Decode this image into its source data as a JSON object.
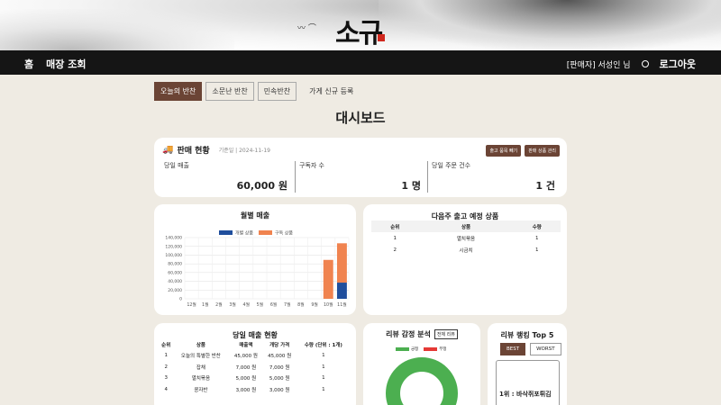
{
  "header": {
    "logo_text": "소규",
    "nav_left": [
      "홈",
      "매장 조회"
    ],
    "seller": "[판매자] 서성인 님",
    "logout": "로그아웃"
  },
  "store_tabs": [
    {
      "label": "오늘의 반찬",
      "active": true
    },
    {
      "label": "소문난 반찬",
      "active": false
    },
    {
      "label": "민속반찬",
      "active": false
    }
  ],
  "register_label": "가게 신규 등록",
  "page_title": "대시보드",
  "sales": {
    "title": "판매 현황",
    "date": "기준일 | 2024-11-19",
    "btn_bulk": "출고 품목 빼기",
    "btn_manage": "판매 상품 관리",
    "metrics": [
      {
        "label": "당일 매출",
        "value": "60,000 원"
      },
      {
        "label": "구독자 수",
        "value": "1 명"
      },
      {
        "label": "당일 주문 건수",
        "value": "1 건"
      }
    ]
  },
  "monthly_chart": {
    "title": "월별 매출"
  },
  "chart_data": {
    "type": "bar",
    "stacked": true,
    "categories": [
      "12월",
      "1월",
      "2월",
      "3월",
      "4월",
      "5월",
      "6월",
      "7월",
      "8월",
      "9월",
      "10월",
      "11월"
    ],
    "series": [
      {
        "name": "개별 상품",
        "color": "#1f4e9c",
        "values": [
          0,
          0,
          0,
          0,
          0,
          0,
          0,
          0,
          0,
          0,
          0,
          37000
        ]
      },
      {
        "name": "구독 상품",
        "color": "#f0834f",
        "values": [
          0,
          0,
          0,
          0,
          0,
          0,
          0,
          0,
          0,
          0,
          89000,
          90000
        ]
      }
    ],
    "ylim": [
      0,
      140000
    ],
    "yticks": [
      "0",
      "20,000",
      "40,000",
      "60,000",
      "80,000",
      "100,000",
      "120,000",
      "140,000"
    ],
    "grid": true,
    "legend": "top"
  },
  "next_week": {
    "title": "다음주 출고 예정 상품",
    "headers": [
      "순위",
      "상품",
      "수량"
    ],
    "rows": [
      [
        "1",
        "멸치볶음",
        "1"
      ],
      [
        "2",
        "시금치",
        "1"
      ]
    ]
  },
  "today_sales": {
    "title": "당일 매출 현황",
    "headers": [
      "순위",
      "상품",
      "매출액",
      "개당 가격",
      "수량 (단위 : 1개)"
    ],
    "rows": [
      [
        "1",
        "오늘의 특별한 반찬",
        "45,000 원",
        "45,000 원",
        "1"
      ],
      [
        "2",
        "잡채",
        "7,000 원",
        "7,000 원",
        "1"
      ],
      [
        "3",
        "멸치볶음",
        "5,000 원",
        "5,000 원",
        "1"
      ],
      [
        "4",
        "콩자반",
        "3,000 원",
        "3,000 원",
        "1"
      ]
    ]
  },
  "review_analysis": {
    "title": "리뷰 감정 분석",
    "all_btn": "전체 리뷰",
    "legend": [
      {
        "name": "긍정",
        "color": "#4caf50"
      },
      {
        "name": "부정",
        "color": "#e53935"
      }
    ],
    "positive_share": 1.0
  },
  "review_rank": {
    "title": "리뷰 랭킹 Top 5",
    "best": "BEST",
    "worst": "WORST",
    "item": "1위 : 바삭쥐포튀김"
  }
}
